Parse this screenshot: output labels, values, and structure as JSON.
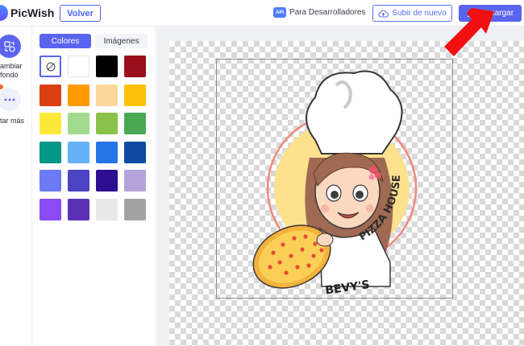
{
  "app": {
    "brand": "PicWish"
  },
  "header": {
    "back_label": "Volver",
    "api_badge": "API",
    "dev_link": "Para Desarrolladores",
    "upload_label": "Subir de nuevo",
    "download_label": "Descargar"
  },
  "sidebar": {
    "tools": [
      {
        "label_line1": "ambiar",
        "label_line2": "fondo",
        "icon": "change-background-icon"
      },
      {
        "label_line1": "tar más",
        "icon": "more-icon"
      }
    ]
  },
  "panel": {
    "tabs": [
      {
        "label": "Colores",
        "active": true
      },
      {
        "label": "Imágenes",
        "active": false
      }
    ],
    "swatches": [
      "none",
      "#ffffff",
      "#000000",
      "#9b0f1c",
      "#d93f12",
      "#ff9a00",
      "#fcd79b",
      "#fec107",
      "#fde83a",
      "#a1d98e",
      "#8bc34a",
      "#4aa953",
      "#009688",
      "#66b2f8",
      "#2375e4",
      "#0e4ba4",
      "#6d7af6",
      "#4b43c2",
      "#2d0e91",
      "#b4a2d9",
      "#8b4cf7",
      "#5b31b6",
      "#e8e8e8",
      "#a3a3a3"
    ]
  },
  "canvas": {
    "logo_text": "BEVY'S PIZZA HOUSE",
    "logo_text_top": "PIZZA HOUSE",
    "logo_text_bottom": "BEVY'S"
  },
  "colors": {
    "accent": "#5a64ee",
    "arrow": "#f10f0f"
  }
}
